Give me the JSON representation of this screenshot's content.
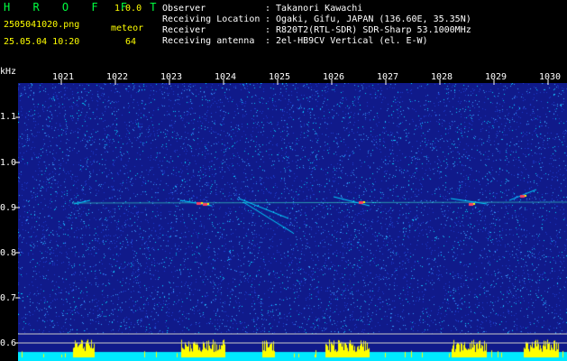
{
  "app": {
    "name": "H R O F F T",
    "version": "1.0.0"
  },
  "file": {
    "name": "2505041020.png",
    "datetime": "25.05.04 10:20"
  },
  "detection": {
    "label": "meteor",
    "count": "64"
  },
  "info": [
    {
      "key": "Observer",
      "sep": ":",
      "value": "Takanori Kawachi"
    },
    {
      "key": "Receiving Location",
      "sep": ":",
      "value": "Ogaki, Gifu, JAPAN (136.60E, 35.35N)"
    },
    {
      "key": "Receiver",
      "sep": ":",
      "value": "R820T2(RTL-SDR) SDR-Sharp 53.1000MHz"
    },
    {
      "key": "Receiving antenna",
      "sep": ":",
      "value": "2el-HB9CV Vertical (el. E-W)"
    }
  ],
  "axes": {
    "y_unit": "kHz",
    "x_ticks": [
      "1021",
      "1022",
      "1023",
      "1024",
      "1025",
      "1026",
      "1027",
      "1028",
      "1029",
      "1030"
    ],
    "y_ticks": [
      "1.1",
      "1.0",
      "0.9",
      "0.8",
      "0.7",
      "0.6"
    ]
  },
  "colors": {
    "background": "#101a8a",
    "noise_light": "#3aa0ff",
    "noise_cyan": "#00d8ff",
    "signal_line": "#40ffd0",
    "meteor_hot": "#ff4060",
    "meteor_yellow": "#ffff00",
    "bottom_bar_cyan": "#00e8ff",
    "bottom_bar_yellow": "#ffff00"
  }
}
